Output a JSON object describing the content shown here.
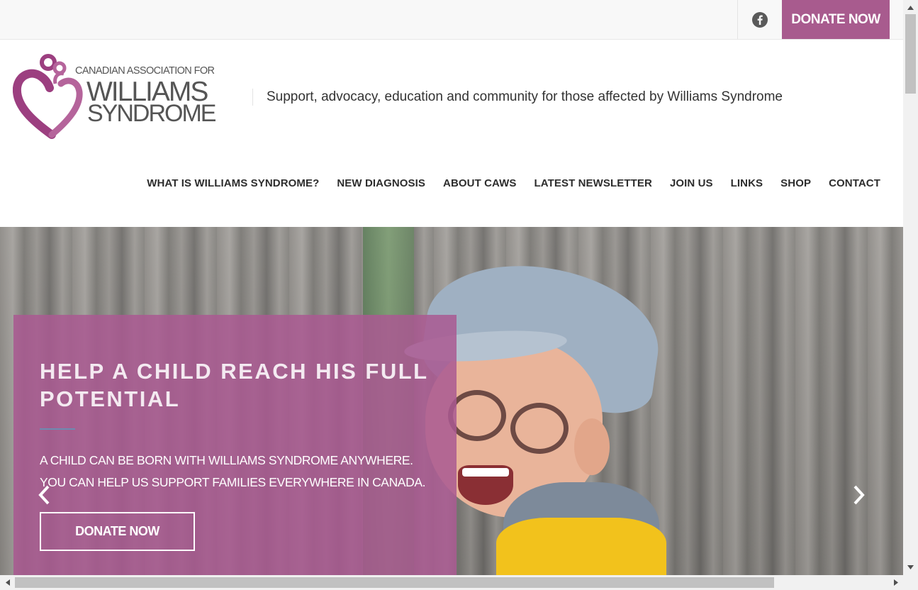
{
  "topbar": {
    "facebook_icon": "facebook-icon",
    "donate_label": "DONATE NOW"
  },
  "header": {
    "logo_line1": "CANADIAN ASSOCIATION FOR",
    "logo_line2": "WILLIAMS",
    "logo_line3": "SYNDROME",
    "tagline": "Support, advocacy, education and community for those affected by Williams Syndrome"
  },
  "nav": {
    "items": [
      {
        "label": "WHAT IS WILLIAMS SYNDROME?"
      },
      {
        "label": "NEW DIAGNOSIS"
      },
      {
        "label": "ABOUT CAWS"
      },
      {
        "label": "LATEST NEWSLETTER"
      },
      {
        "label": "JOIN US"
      },
      {
        "label": "LINKS"
      },
      {
        "label": "SHOP"
      },
      {
        "label": "CONTACT"
      }
    ]
  },
  "hero": {
    "title": "HELP A CHILD REACH HIS FULL POTENTIAL",
    "text": "A child can be born with Williams Syndrome anywhere. You can help us support families everywhere in Canada.",
    "button_label": "DONATE NOW",
    "prev_icon": "chevron-left-icon",
    "next_icon": "chevron-right-icon"
  },
  "colors": {
    "brand": "#a85b8e",
    "overlay": "#aa5a91",
    "text_dark": "#2d2d2d"
  }
}
